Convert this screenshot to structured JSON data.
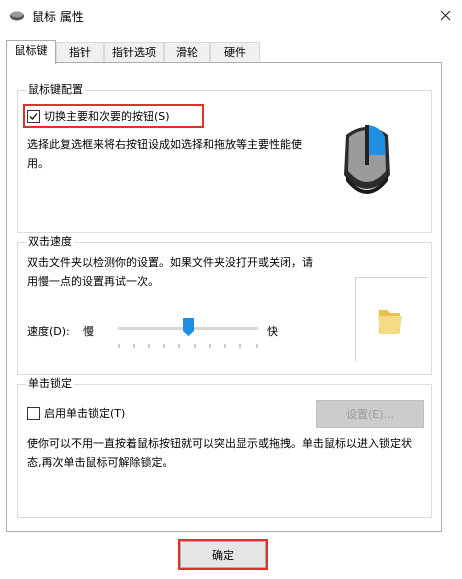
{
  "window": {
    "title": "鼠标 属性",
    "close_icon": "close-icon"
  },
  "tabs": [
    {
      "label": "鼠标键",
      "active": true
    },
    {
      "label": "指针",
      "active": false
    },
    {
      "label": "指针选项",
      "active": false
    },
    {
      "label": "滑轮",
      "active": false
    },
    {
      "label": "硬件",
      "active": false
    }
  ],
  "button_config": {
    "group_label": "鼠标键配置",
    "switch_checkbox_label": "切换主要和次要的按钮(S)",
    "switch_checked": true,
    "description": "选择此复选框来将右按钮设成如选择和拖放等主要性能使用。",
    "mouse_image": "mouse-icon"
  },
  "double_click": {
    "group_label": "双击速度",
    "description": "双击文件夹以检测你的设置。如果文件夹没打开或关闭，请用慢一点的设置再试一次。",
    "speed_label": "速度(D):",
    "slow_label": "慢",
    "fast_label": "快",
    "speed_value": 0.5,
    "folder_image": "folder-icon"
  },
  "click_lock": {
    "group_label": "单击锁定",
    "checkbox_label": "启用单击锁定(T)",
    "checked": false,
    "settings_button": "设置(E)...",
    "description": "使你可以不用一直按着鼠标按钮就可以突出显示或拖拽。单击鼠标以进入锁定状态,再次单击鼠标可解除锁定。"
  },
  "footer": {
    "ok_button": "确定"
  },
  "colors": {
    "accent": "#1f8fe5",
    "highlight": "#e0322b"
  }
}
